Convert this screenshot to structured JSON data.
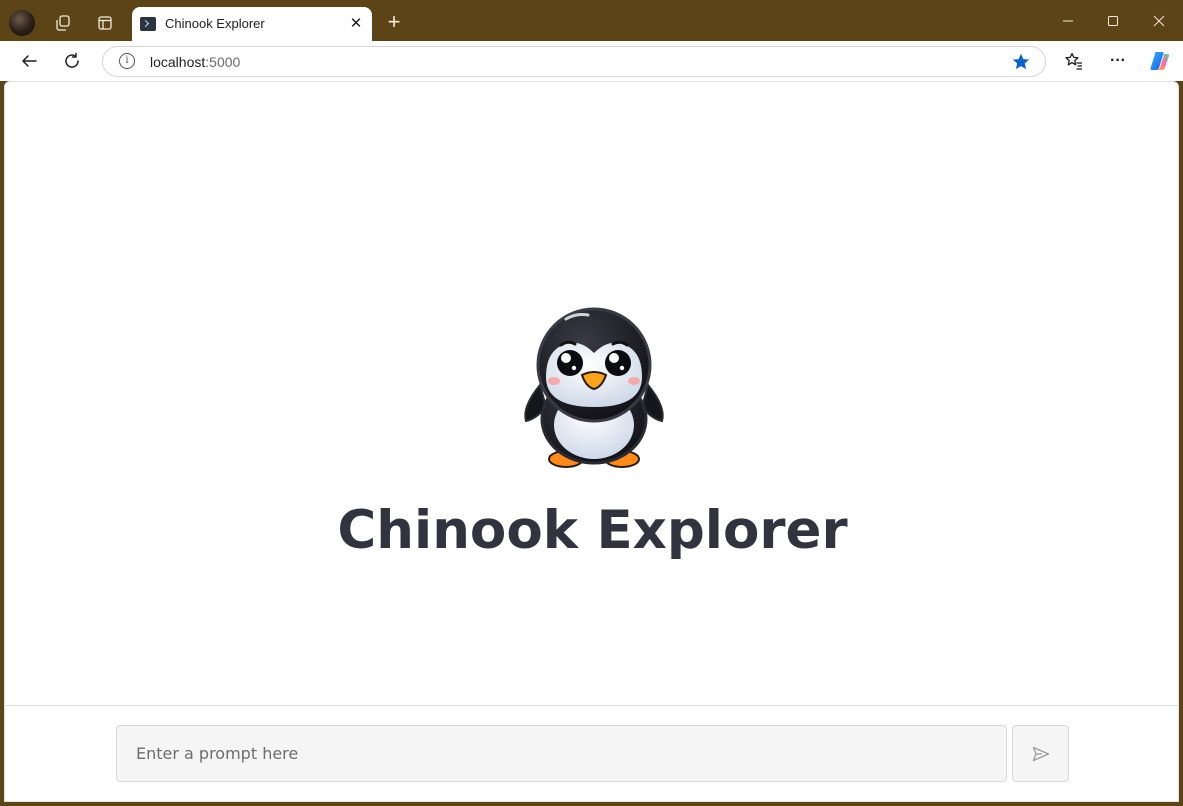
{
  "browser": {
    "tab_title": "Chinook Explorer",
    "new_tab_symbol": "+",
    "close_symbol": "✕",
    "window_controls": {
      "minimize": "—",
      "maximize": "☐",
      "close": "✕"
    },
    "address": {
      "host": "localhost",
      "port": ":5000"
    },
    "menu_symbol": "···",
    "icons": [
      "profile-avatar",
      "workspaces-icon",
      "tab-actions-icon",
      "terminal-favicon",
      "back-icon",
      "refresh-icon",
      "site-info-icon",
      "favorite-star-icon",
      "favorites-icon",
      "more-icon",
      "copilot-icon"
    ],
    "accent_color": "#0a64c8",
    "frame_color": "#5c4417"
  },
  "page": {
    "mascot": "penguin-mascot",
    "heading": "Chinook Explorer",
    "prompt": {
      "placeholder": "Enter a prompt here",
      "value": ""
    },
    "send_icon": "send-icon"
  }
}
